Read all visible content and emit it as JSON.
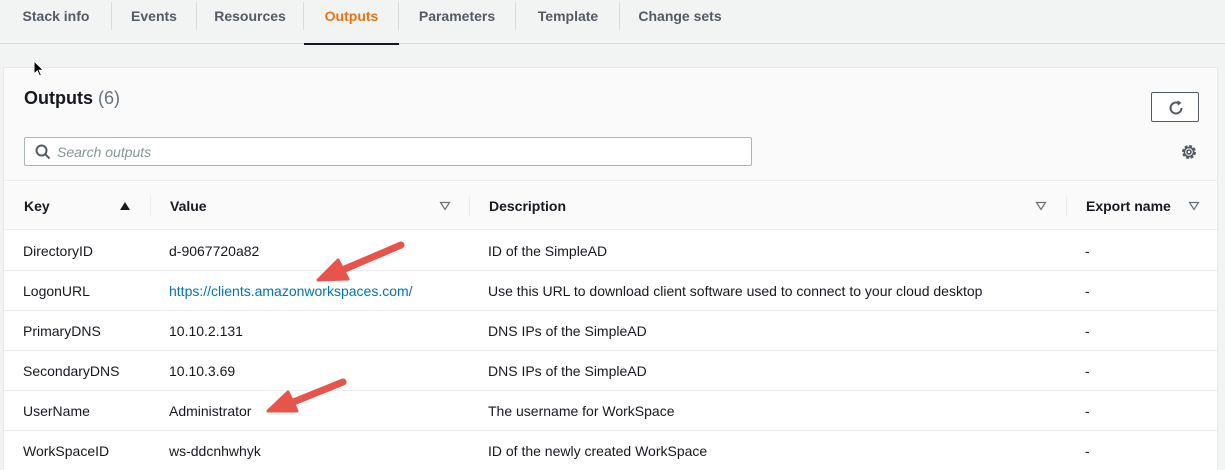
{
  "tabs": [
    {
      "label": "Stack info"
    },
    {
      "label": "Events"
    },
    {
      "label": "Resources"
    },
    {
      "label": "Outputs",
      "active": true
    },
    {
      "label": "Parameters"
    },
    {
      "label": "Template"
    },
    {
      "label": "Change sets"
    }
  ],
  "panel": {
    "title": "Outputs",
    "count": "(6)",
    "search_placeholder": "Search outputs"
  },
  "columns": [
    "Key",
    "Value",
    "Description",
    "Export name"
  ],
  "rows": [
    {
      "key": "DirectoryID",
      "value": "d-9067720a82",
      "description": "ID of the SimpleAD",
      "export": "-"
    },
    {
      "key": "LogonURL",
      "value": "https://clients.amazonworkspaces.com/",
      "description": "Use this URL to download client software used to connect to your cloud desktop",
      "export": "-"
    },
    {
      "key": "PrimaryDNS",
      "value": "10.10.2.131",
      "description": "DNS IPs of the SimpleAD",
      "export": "-"
    },
    {
      "key": "SecondaryDNS",
      "value": "10.10.3.69",
      "description": "DNS IPs of the SimpleAD",
      "export": "-"
    },
    {
      "key": "UserName",
      "value": "Administrator",
      "description": "The username for WorkSpace",
      "export": "-"
    },
    {
      "key": "WorkSpaceID",
      "value": "ws-ddcnhwhyk",
      "description": "ID of the newly created WorkSpace",
      "export": "-"
    }
  ],
  "colors": {
    "accent": "#ec7211",
    "link": "#0073bb",
    "annotation_arrow": "#e8534a"
  },
  "icons": [
    "refresh-icon",
    "search-icon",
    "settings-gear-icon",
    "sort-ascending-icon",
    "filter-triangle-icon",
    "mouse-cursor-icon"
  ]
}
